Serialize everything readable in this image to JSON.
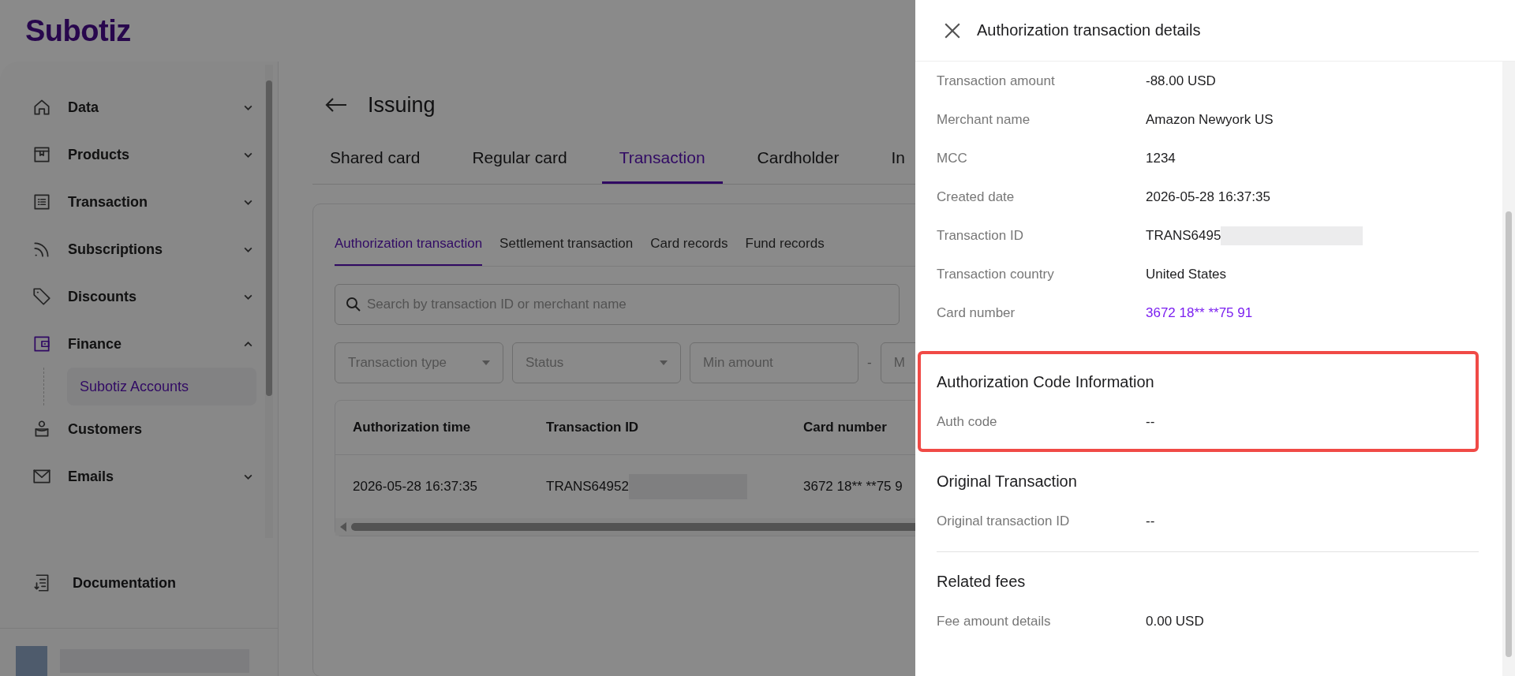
{
  "header": {
    "logo": "Subotiz"
  },
  "sidebar": {
    "items": [
      {
        "label": "Data",
        "selected": false,
        "expanded": false
      },
      {
        "label": "Products",
        "selected": false,
        "expanded": false
      },
      {
        "label": "Transaction",
        "selected": false,
        "expanded": false
      },
      {
        "label": "Subscriptions",
        "selected": false,
        "expanded": false
      },
      {
        "label": "Discounts",
        "selected": false,
        "expanded": false
      },
      {
        "label": "Finance",
        "selected": true,
        "expanded": true,
        "children": [
          {
            "label": "Subotiz Accounts",
            "selected": true
          }
        ]
      },
      {
        "label": "Customers",
        "selected": false
      },
      {
        "label": "Emails",
        "selected": false,
        "expanded": false
      }
    ],
    "footer_link": {
      "label": "Documentation"
    }
  },
  "page": {
    "title": "Issuing",
    "tabs": [
      {
        "label": "Shared card",
        "selected": false
      },
      {
        "label": "Regular card",
        "selected": false
      },
      {
        "label": "Transaction",
        "selected": true
      },
      {
        "label": "Cardholder",
        "selected": false
      },
      {
        "label": "In",
        "selected": false
      }
    ],
    "subtabs": [
      {
        "label": "Authorization transaction",
        "selected": true
      },
      {
        "label": "Settlement transaction",
        "selected": false
      },
      {
        "label": "Card records",
        "selected": false
      },
      {
        "label": "Fund records",
        "selected": false
      }
    ],
    "search": {
      "placeholder": "Search by transaction ID or merchant name"
    },
    "filters": [
      {
        "kind": "select",
        "placeholder": "Transaction type"
      },
      {
        "kind": "select",
        "placeholder": "Status"
      },
      {
        "kind": "input",
        "placeholder": "Min amount"
      },
      {
        "kind": "separator",
        "text": "-"
      },
      {
        "kind": "input",
        "placeholder": "M"
      }
    ],
    "table": {
      "columns": [
        "Authorization time",
        "Transaction ID",
        "Card number"
      ],
      "rows": [
        {
          "cells": [
            {
              "text": "2026-05-28 16:37:35",
              "redacted": false
            },
            {
              "text": "TRANS64952",
              "redacted": true
            },
            {
              "text": "3672 18** **75 9",
              "redacted": false
            }
          ]
        }
      ]
    }
  },
  "drawer": {
    "title": "Authorization transaction details",
    "fields": [
      {
        "label": "Transaction amount",
        "value": "-88.00 USD",
        "kind": "text"
      },
      {
        "label": "Merchant name",
        "value": "Amazon Newyork US",
        "kind": "text"
      },
      {
        "label": "MCC",
        "value": "1234",
        "kind": "text"
      },
      {
        "label": "Created date",
        "value": "2026-05-28 16:37:35",
        "kind": "text"
      },
      {
        "label": "Transaction ID",
        "value": "TRANS6495",
        "kind": "redacted"
      },
      {
        "label": "Transaction country",
        "value": "United States",
        "kind": "text"
      },
      {
        "label": "Card number",
        "value": "3672 18** **75 91",
        "kind": "link"
      }
    ],
    "sections": [
      {
        "title": "Authorization Code Information",
        "highlighted": true,
        "divider_above": false,
        "fields": [
          {
            "label": "Auth code",
            "value": "--"
          }
        ]
      },
      {
        "title": "Original Transaction",
        "highlighted": false,
        "divider_above": false,
        "fields": [
          {
            "label": "Original transaction ID",
            "value": "--"
          }
        ]
      },
      {
        "title": "Related fees",
        "highlighted": false,
        "divider_above": true,
        "fields": [
          {
            "label": "Fee amount details",
            "value": "0.00 USD"
          }
        ]
      }
    ]
  }
}
